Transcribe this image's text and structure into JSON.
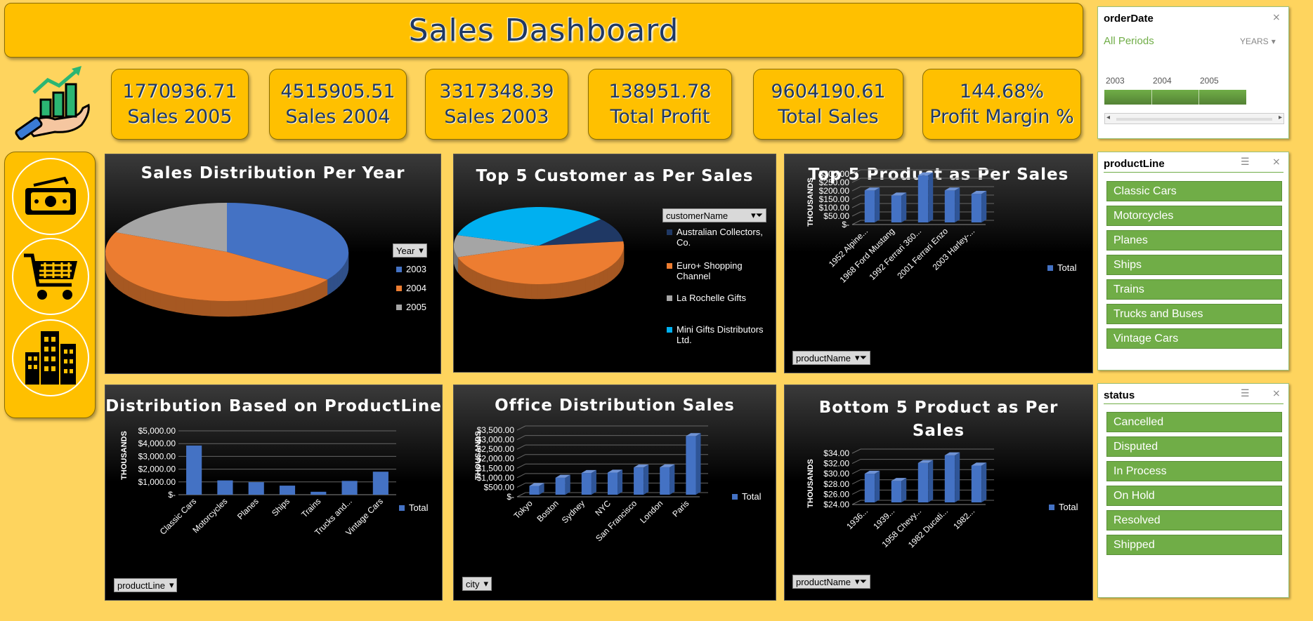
{
  "title": "Sales Dashboard",
  "kpis": [
    {
      "value": "1770936.71",
      "label": "Sales 2005"
    },
    {
      "value": "4515905.51",
      "label": "Sales 2004"
    },
    {
      "value": "3317348.39",
      "label": "Sales 2003"
    },
    {
      "value": "138951.78",
      "label": "Total Profit"
    },
    {
      "value": "9604190.61",
      "label": "Total Sales"
    },
    {
      "value": "144.68%",
      "label": "Profit Margin %"
    }
  ],
  "side_icons": [
    "money-icon",
    "cart-icon",
    "buildings-icon"
  ],
  "colors": {
    "accent": "#ffc000",
    "background": "#fed45e",
    "slicer_green": "#70ad47",
    "bar_blue": "#4472c4"
  },
  "panels": {
    "pie_year": {
      "title": "Sales Distribution Per Year",
      "field_button": "Year",
      "legend": [
        "2003",
        "2004",
        "2005"
      ]
    },
    "pie_customer": {
      "title": "Top 5 Customer as Per Sales",
      "field_button": "customerName",
      "legend": [
        "Australian Collectors, Co.",
        "Euro+ Shopping Channel",
        "La Rochelle Gifts",
        "Mini Gifts Distributors Ltd."
      ]
    },
    "top5": {
      "title": "Top 5 Product as Per Sales",
      "field_button": "productName",
      "axis_unit": "THOUSANDS",
      "legend": "Total"
    },
    "productline": {
      "title": "Distribution Based on ProductLine",
      "field_button": "productLine",
      "axis_unit": "THOUSANDS",
      "legend": "Total"
    },
    "office": {
      "title": "Office Distribution Sales",
      "field_button": "city",
      "axis_unit": "THOUSANDS",
      "legend": "Total"
    },
    "bottom5": {
      "title": "Bottom 5 Product as Per Sales",
      "field_button": "productName",
      "axis_unit": "THOUSANDS",
      "legend": "Total"
    }
  },
  "chart_data": [
    {
      "type": "pie",
      "title": "Sales Distribution Per Year",
      "categories": [
        "2003",
        "2004",
        "2005"
      ],
      "values": [
        3317348.39,
        4515905.51,
        1770936.71
      ],
      "colors": [
        "#4472c4",
        "#ed7d31",
        "#a5a5a5"
      ]
    },
    {
      "type": "pie",
      "title": "Top 5 Customer as Per Sales",
      "categories": [
        "Australian Collectors, Co.",
        "Euro+ Shopping Channel",
        "La Rochelle Gifts",
        "Mini Gifts Distributors Ltd."
      ],
      "values": [
        200,
        912,
        180,
        654
      ],
      "colors": [
        "#1f3864",
        "#ed7d31",
        "#a5a5a5",
        "#00b0f0"
      ]
    },
    {
      "type": "bar",
      "title": "Top 5 Product as Per Sales",
      "categories": [
        "1952 Alpine...",
        "1968 Ford Mustang",
        "1992 Ferrari 360...",
        "2001 Ferrari Enzo",
        "2003 Harley-..."
      ],
      "ticks": [
        "$300.00",
        "$250.00",
        "$200.00",
        "$150.00",
        "$100.00",
        "$50.00",
        "$-"
      ],
      "values": [
        190,
        160,
        280,
        190,
        170
      ],
      "ylim": [
        0,
        300
      ],
      "ylabel": "THOUSANDS"
    },
    {
      "type": "bar",
      "title": "Distribution Based on ProductLine",
      "categories": [
        "Classic Cars",
        "Motorcycles",
        "Planes",
        "Ships",
        "Trains",
        "Trucks and...",
        "Vintage Cars"
      ],
      "ticks": [
        "$5,000.00",
        "$4,000.00",
        "$3,000.00",
        "$2,000.00",
        "$1,000.00",
        "$-"
      ],
      "values": [
        3850,
        1120,
        980,
        710,
        230,
        1080,
        1800
      ],
      "ylim": [
        0,
        5000
      ],
      "ylabel": "THOUSANDS"
    },
    {
      "type": "bar",
      "title": "Office Distribution Sales",
      "categories": [
        "Tokyo",
        "Boston",
        "Sydney",
        "NYC",
        "San Francisco",
        "London",
        "Paris"
      ],
      "ticks": [
        "$3,500.00",
        "$3,000.00",
        "$2,500.00",
        "$2,000.00",
        "$1,500.00",
        "$1,000.00",
        "$500.00",
        "$-"
      ],
      "values": [
        460,
        890,
        1140,
        1160,
        1430,
        1440,
        3080
      ],
      "ylim": [
        0,
        3500
      ],
      "ylabel": "THOUSANDS"
    },
    {
      "type": "bar",
      "title": "Bottom 5 Product as Per Sales",
      "categories": [
        "1936...",
        "1939...",
        "1958 Chevy...",
        "1982 Ducati...",
        "1982..."
      ],
      "ticks": [
        "$34.00",
        "$32.00",
        "$30.00",
        "$28.00",
        "$26.00",
        "$24.00"
      ],
      "values": [
        29.6,
        28.2,
        31.7,
        33.2,
        31.2
      ],
      "ylim": [
        24,
        34
      ],
      "ylabel": "THOUSANDS"
    }
  ],
  "slicers": {
    "orderDate": {
      "title": "orderDate",
      "period": "All Periods",
      "level": "YEARS",
      "years": [
        "2003",
        "2004",
        "2005"
      ]
    },
    "productLine": {
      "title": "productLine",
      "items": [
        "Classic Cars",
        "Motorcycles",
        "Planes",
        "Ships",
        "Trains",
        "Trucks and Buses",
        "Vintage Cars"
      ]
    },
    "status": {
      "title": "status",
      "items": [
        "Cancelled",
        "Disputed",
        "In Process",
        "On Hold",
        "Resolved",
        "Shipped"
      ]
    }
  }
}
